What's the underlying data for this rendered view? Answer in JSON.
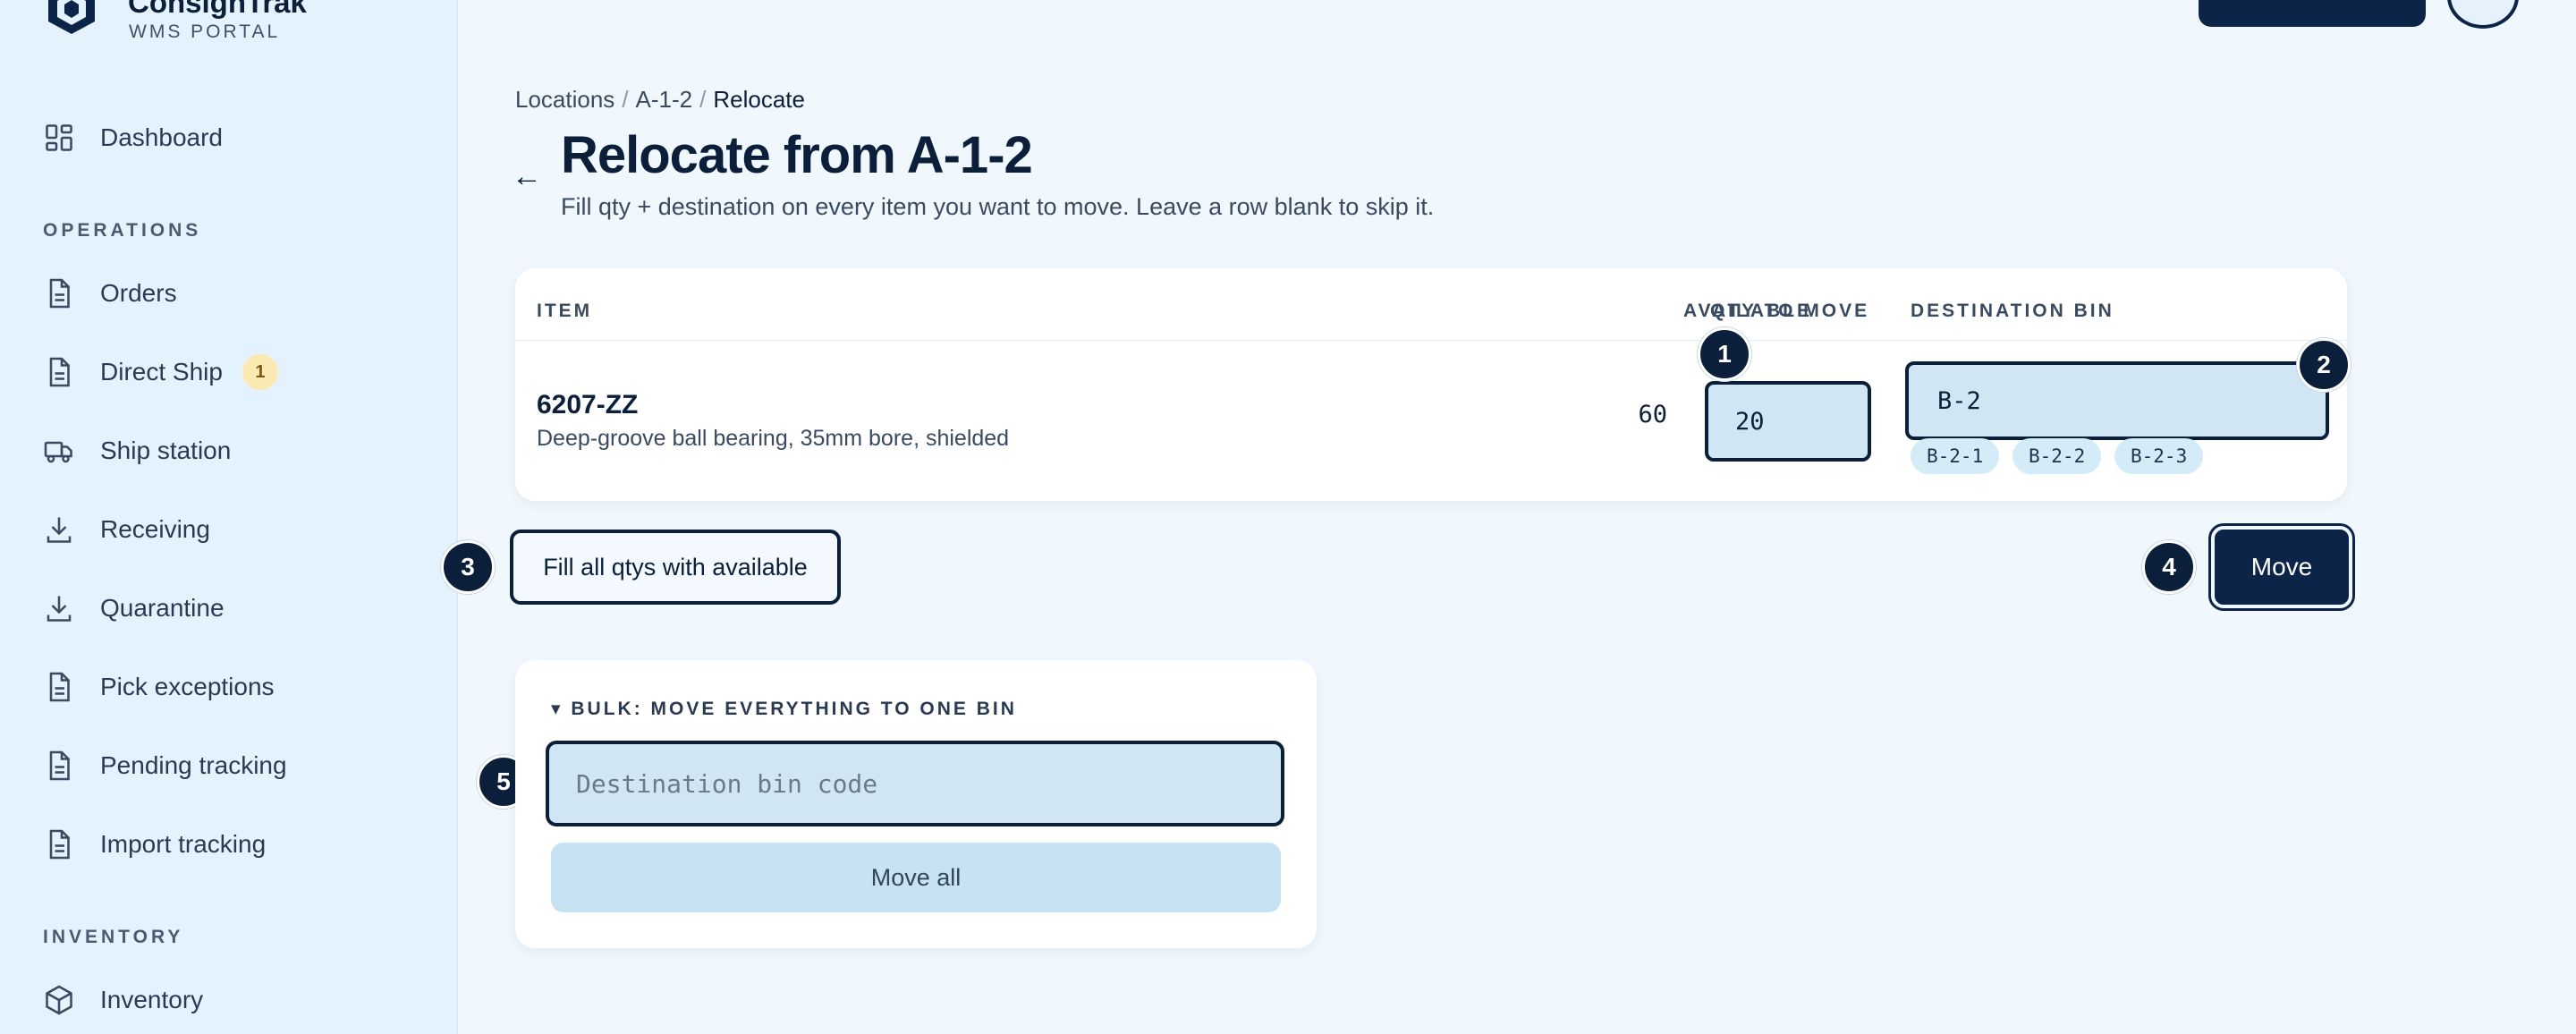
{
  "brand": {
    "name": "ConsignTrak",
    "subtitle": "WMS PORTAL"
  },
  "sidebar": {
    "items": [
      {
        "label": "Dashboard",
        "icon": "grid-icon"
      },
      {
        "label": "Orders",
        "icon": "document-icon"
      },
      {
        "label": "Direct Ship",
        "icon": "document-icon",
        "badge": "1"
      },
      {
        "label": "Ship station",
        "icon": "truck-icon"
      },
      {
        "label": "Receiving",
        "icon": "download-icon"
      },
      {
        "label": "Quarantine",
        "icon": "download-icon"
      },
      {
        "label": "Pick exceptions",
        "icon": "document-icon"
      },
      {
        "label": "Pending tracking",
        "icon": "document-icon"
      },
      {
        "label": "Import tracking",
        "icon": "document-icon"
      },
      {
        "label": "Inventory",
        "icon": "box-icon"
      }
    ],
    "sections": {
      "operations": "OPERATIONS",
      "inventory": "INVENTORY"
    }
  },
  "breadcrumb": {
    "items": [
      "Locations",
      "A-1-2",
      "Relocate"
    ],
    "separator": "/"
  },
  "page": {
    "back_icon": "←",
    "title": "Relocate from A-1-2",
    "subtitle": "Fill qty + destination on every item you want to move. Leave a row blank to skip it."
  },
  "table": {
    "headers": {
      "item": "ITEM",
      "available": "AVAILABLE",
      "qty": "QTY TO MOVE",
      "destination": "DESTINATION BIN"
    },
    "rows": [
      {
        "code": "6207-ZZ",
        "description": "Deep-groove ball bearing, 35mm bore, shielded",
        "available": "60",
        "qty": "20",
        "destination": "B-2",
        "suggestions": [
          "B-2-1",
          "B-2-2",
          "B-2-3"
        ]
      }
    ]
  },
  "actions": {
    "fill_all": "Fill all qtys with available",
    "move": "Move"
  },
  "bulk": {
    "title": "▾ BULK: MOVE EVERYTHING TO ONE BIN",
    "placeholder": "Destination bin code",
    "move_all": "Move all"
  },
  "markers": [
    "1",
    "2",
    "3",
    "4",
    "5"
  ],
  "colors": {
    "primary": "#0b2448",
    "background": "#f0f7fd",
    "sidebar": "#e3f2fc",
    "input_fill": "#d0e6f4",
    "badge": "#fbe9b4"
  }
}
